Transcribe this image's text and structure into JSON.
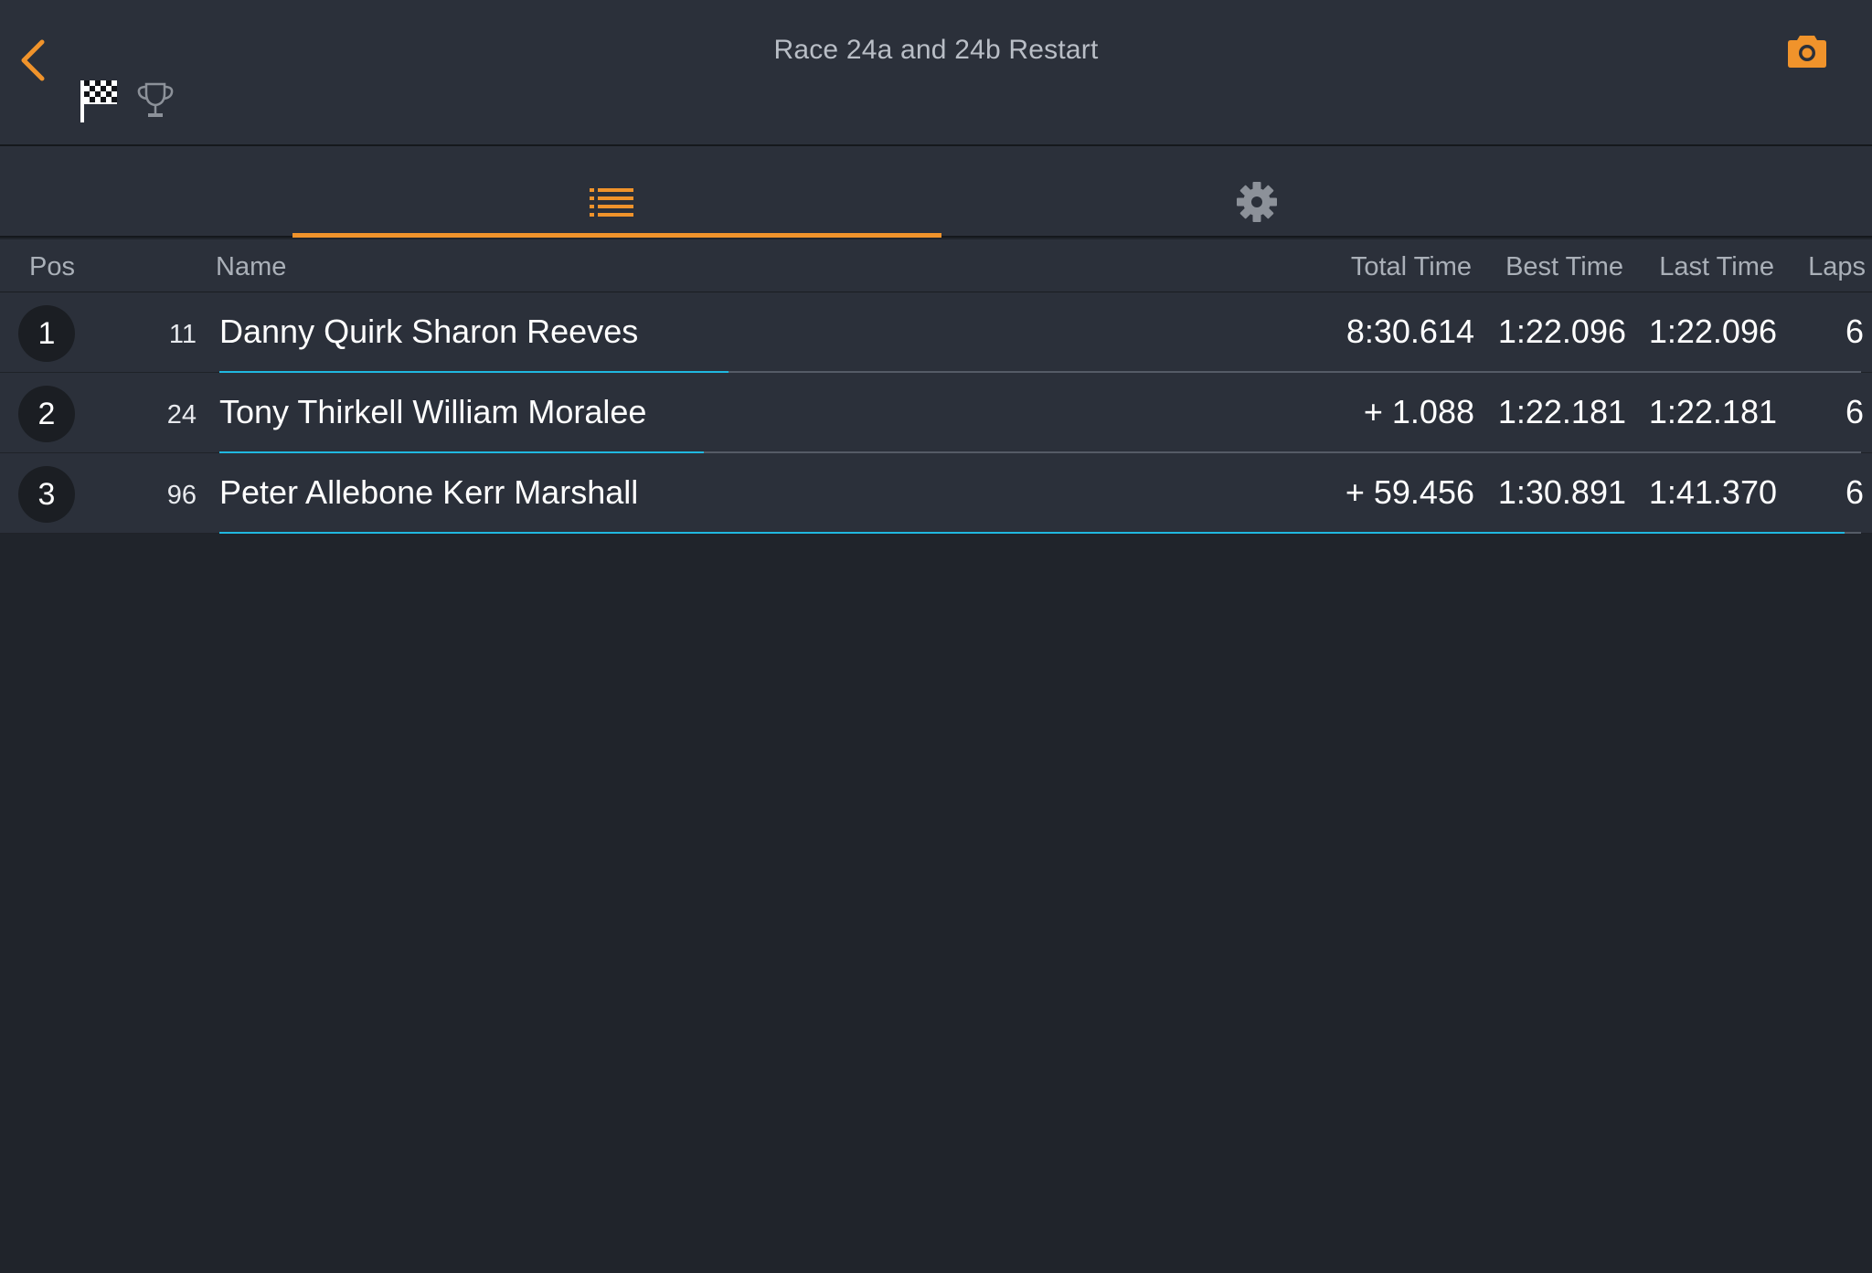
{
  "header": {
    "title": "Race 24a and 24b Restart",
    "icons": [
      "chevron-left-icon",
      "camera-icon",
      "checkered-flag-icon",
      "trophy-icon"
    ]
  },
  "tabs": [
    {
      "icon": "list-icon",
      "selected": true
    },
    {
      "icon": "gear-icon",
      "selected": false
    }
  ],
  "table": {
    "columns": {
      "pos": "Pos",
      "name": "Name",
      "total_time": "Total Time",
      "best_time": "Best Time",
      "last_time": "Last Time",
      "laps": "Laps"
    },
    "rows": [
      {
        "pos": "1",
        "number": "11",
        "name": "Danny Quirk Sharon Reeves",
        "total_time": "8:30.614",
        "best_time": "1:22.096",
        "last_time": "1:22.096",
        "laps": "6",
        "lap_progress": 0.31
      },
      {
        "pos": "2",
        "number": "24",
        "name": "Tony Thirkell William Moralee",
        "total_time": "+ 1.088",
        "best_time": "1:22.181",
        "last_time": "1:22.181",
        "laps": "6",
        "lap_progress": 0.295
      },
      {
        "pos": "3",
        "number": "96",
        "name": "Peter Allebone Kerr Marshall",
        "total_time": "+ 59.456",
        "best_time": "1:30.891",
        "last_time": "1:41.370",
        "laps": "6",
        "lap_progress": 0.99
      }
    ]
  },
  "colors": {
    "accent": "#f0932b",
    "progress": "#20b8e0",
    "header_bg": "#2b303a",
    "page_bg": "#20242b"
  }
}
